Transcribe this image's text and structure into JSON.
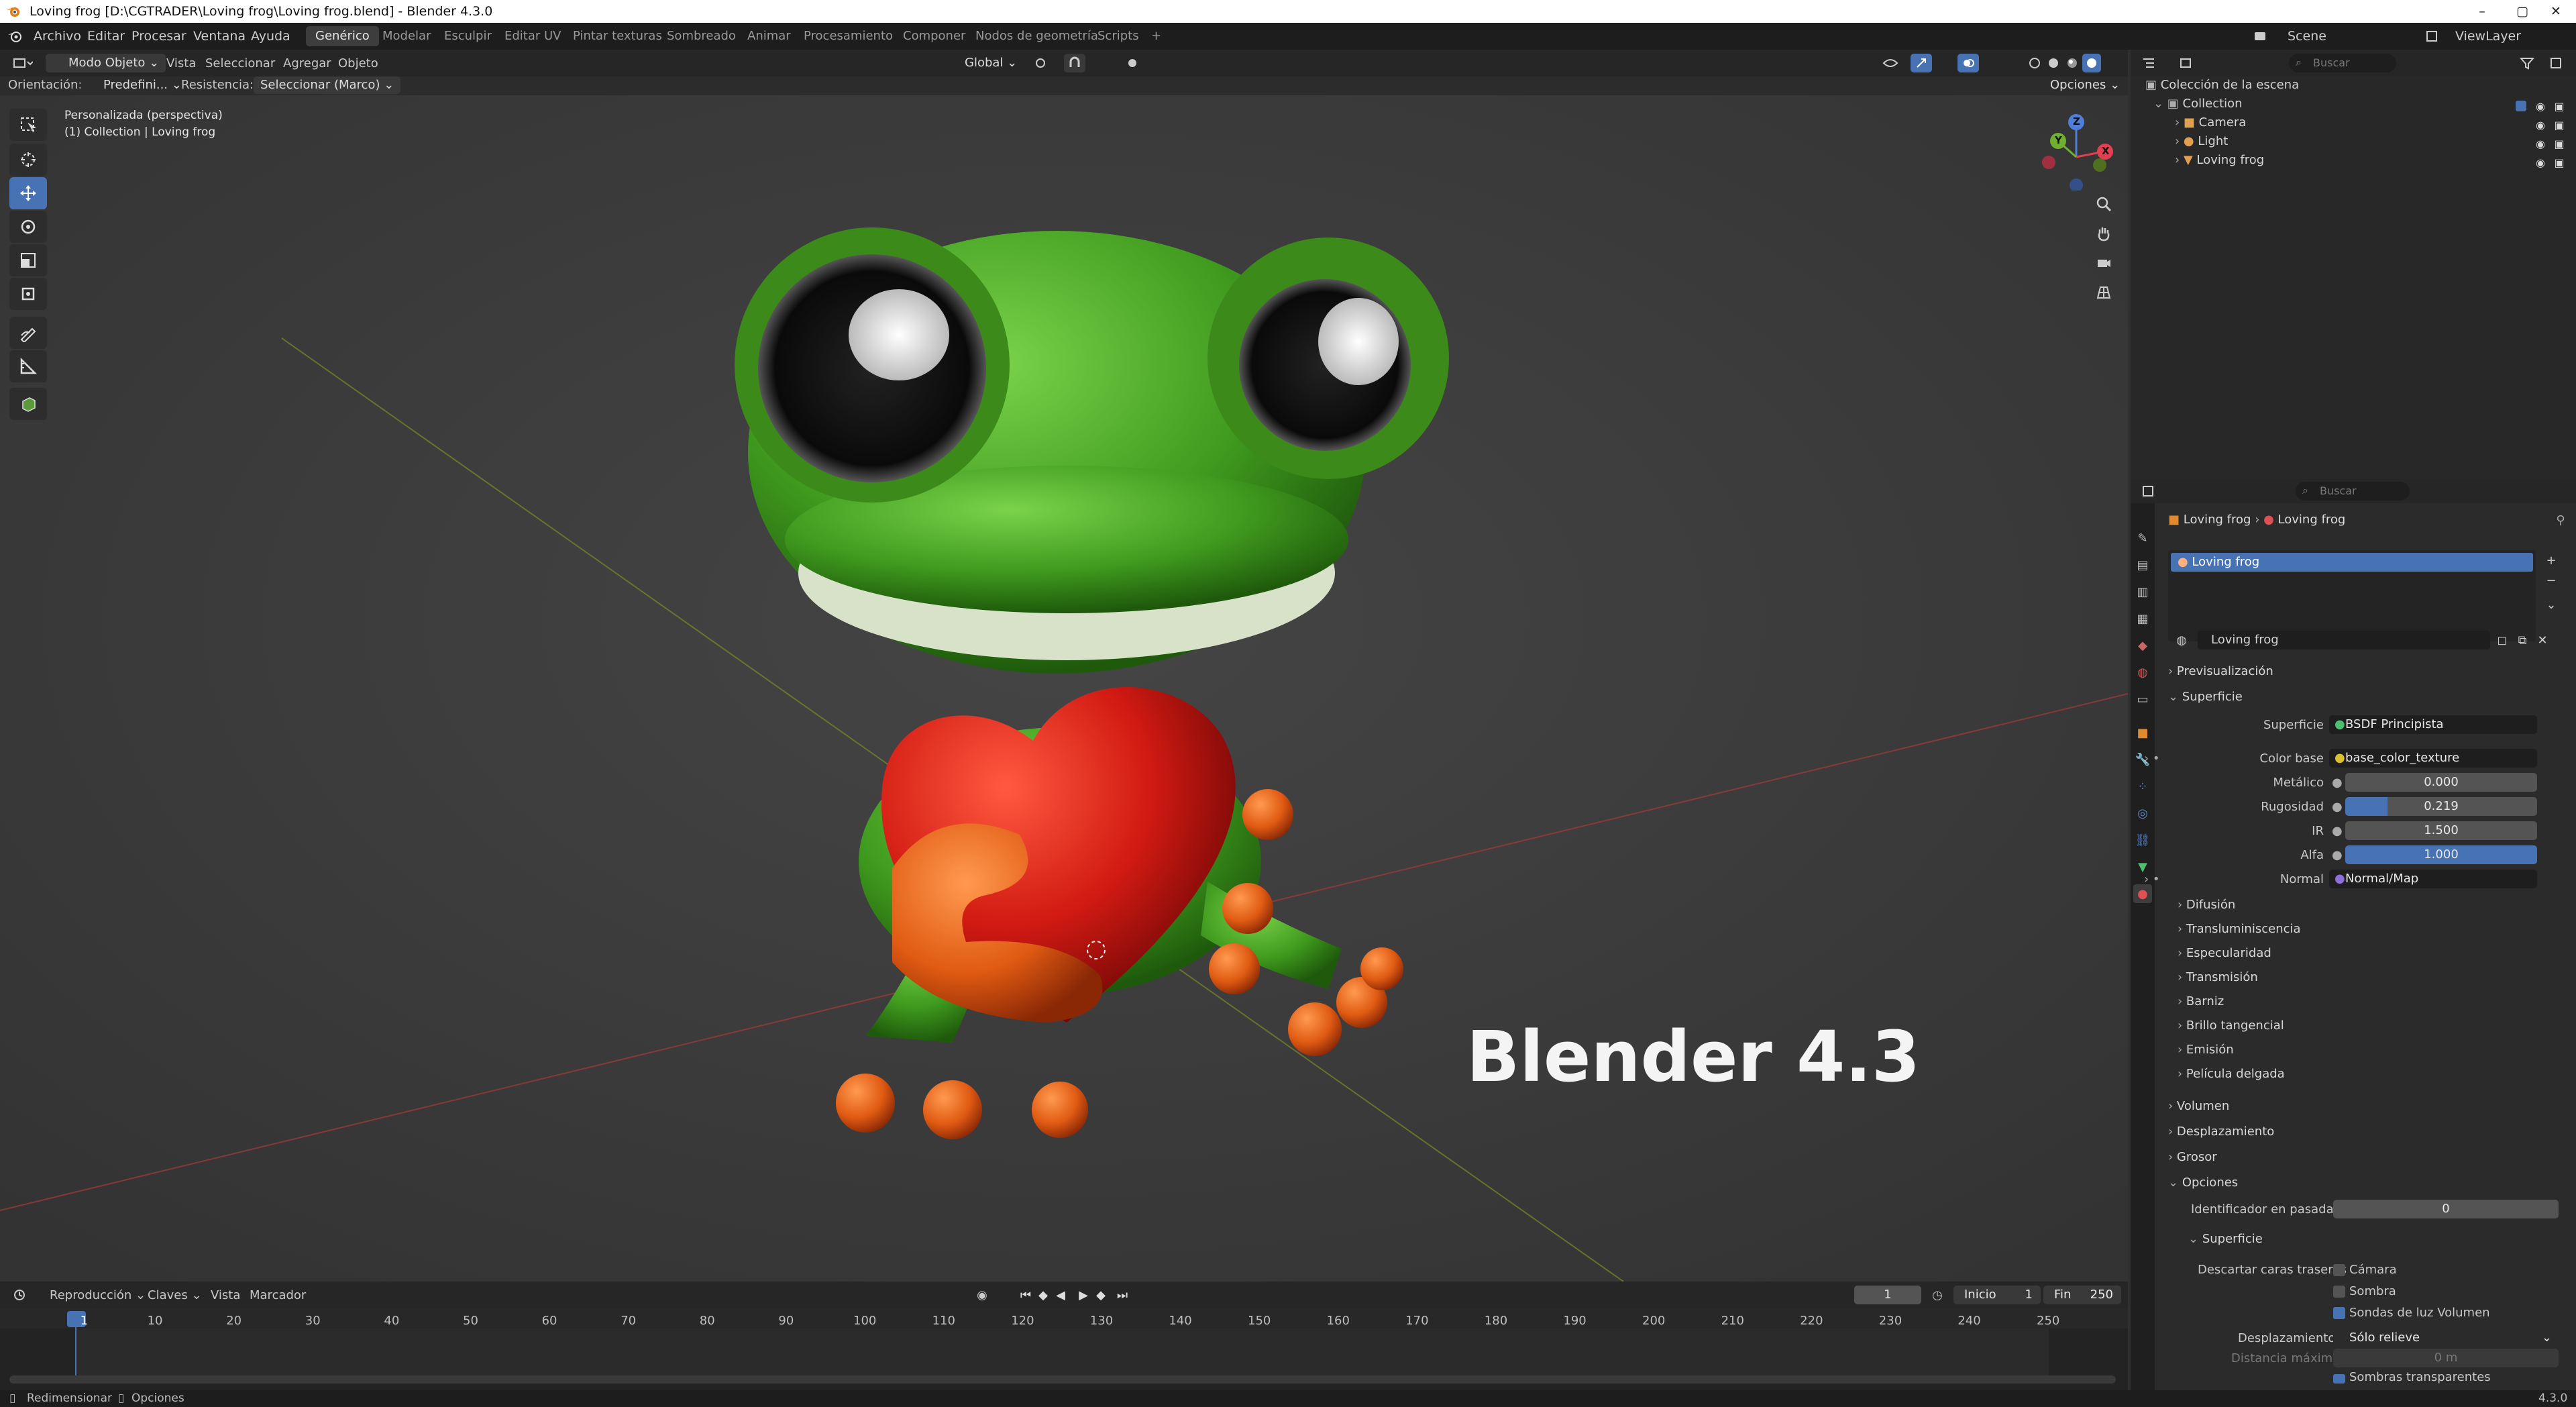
{
  "window": {
    "title": "Loving frog [D:\\CGTRADER\\Loving frog\\Loving frog.blend] - Blender 4.3.0",
    "minimize": "–",
    "maximize": "▢",
    "close": "✕"
  },
  "menu": [
    "Archivo",
    "Editar",
    "Procesar",
    "Ventana",
    "Ayuda"
  ],
  "workspaces": [
    "Genérico",
    "Modelar",
    "Esculpir",
    "Editar UV",
    "Pintar texturas",
    "Sombreado",
    "Animar",
    "Procesamiento",
    "Componer",
    "Nodos de geometría",
    "Scripts",
    "+"
  ],
  "scene": {
    "label": "Scene",
    "viewlayer": "ViewLayer"
  },
  "viewport_header": {
    "mode": "Modo Objeto",
    "menus": [
      "Vista",
      "Seleccionar",
      "Agregar",
      "Objeto"
    ],
    "transform": "Global",
    "options": "Opciones"
  },
  "tool_settings": {
    "orientation_label": "Orientación:",
    "orientation_value": "Predefini...",
    "drag_label": "Resistencia:",
    "drag_value": "Seleccionar (Marco)"
  },
  "viewport": {
    "view_name": "Personalizada (perspectiva)",
    "collection_info": "(1) Collection | Loving frog",
    "overlay_text": "Blender 4.3",
    "axes": {
      "x": "X",
      "y": "Y",
      "z": "Z"
    }
  },
  "outliner": {
    "search_placeholder": "Buscar",
    "root": "Colección de la escena",
    "collection": "Collection",
    "items": [
      "Camera",
      "Light",
      "Loving frog"
    ]
  },
  "properties": {
    "search_placeholder": "Buscar",
    "breadcrumb": [
      "Loving frog",
      "Loving frog"
    ],
    "slot": "Loving frog",
    "material": "Loving frog",
    "sections": {
      "preview": "Previsualización",
      "surface": "Superficie",
      "volume": "Volumen",
      "displacement": "Desplazamiento",
      "thickness": "Grosor",
      "options": "Opciones"
    },
    "surface_shader_label": "Superficie",
    "surface_shader": "BSDF Principista",
    "base_color_label": "Color base",
    "base_color": "base_color_texture",
    "metallic_label": "Metálico",
    "metallic": "0.000",
    "roughness_label": "Rugosidad",
    "roughness": "0.219",
    "roughness_fraction": 0.219,
    "ior_label": "IR",
    "ior": "1.500",
    "alpha_label": "Alfa",
    "alpha": "1.000",
    "alpha_fraction": 1.0,
    "normal_label": "Normal",
    "normal": "Normal/Map",
    "subsections": [
      "Difusión",
      "Transluminiscencia",
      "Especularidad",
      "Transmisión",
      "Barniz",
      "Brillo tangencial",
      "Emisión",
      "Película delgada"
    ],
    "pass_index_label": "Identificador en pasada",
    "pass_index": "0",
    "opt_surface": "Superficie",
    "backface_label": "Descartar caras traseras",
    "backface_camera": "Cámara",
    "backface_shadow": "Sombra",
    "light_probe": "Sondas de luz Volumen",
    "displacement_label": "Desplazamiento",
    "displacement_value": "Sólo relieve",
    "max_distance_label": "Distancia máxima",
    "max_distance": "0 m",
    "transparent_shadows": "Sombras transparentes"
  },
  "timeline": {
    "menus": [
      "Reproducción",
      "Claves",
      "Vista",
      "Marcador"
    ],
    "current_frame": "1",
    "start_label": "Inicio",
    "start": "1",
    "end_label": "Fin",
    "end": "250",
    "ticks": [
      "1",
      "10",
      "20",
      "30",
      "40",
      "50",
      "60",
      "70",
      "80",
      "90",
      "100",
      "110",
      "120",
      "130",
      "140",
      "150",
      "160",
      "170",
      "180",
      "190",
      "200",
      "210",
      "220",
      "230",
      "240",
      "250"
    ]
  },
  "status": {
    "left": "Redimensionar",
    "options": "Opciones",
    "version": "4.3.0"
  },
  "colors": {
    "accent": "#4772b3",
    "frog_green": "#4caa2a",
    "heart_red": "#d11a12",
    "toe_orange": "#e05a12"
  }
}
